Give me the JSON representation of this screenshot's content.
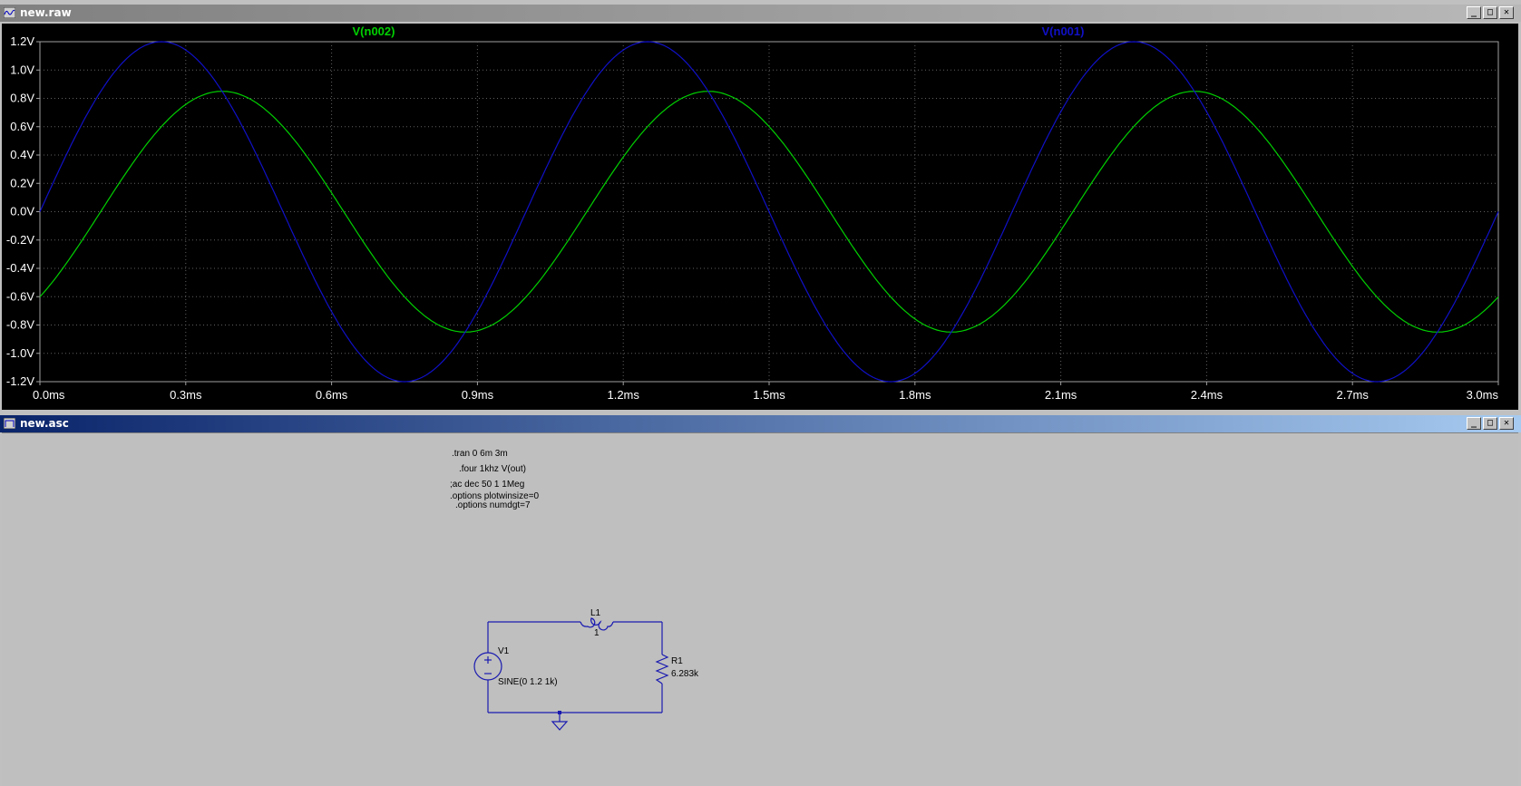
{
  "waveform_window": {
    "title": "new.raw",
    "buttons": {
      "minimize": "_",
      "restore": "□",
      "close": "✕"
    }
  },
  "schematic_window": {
    "title": "new.asc",
    "buttons": {
      "minimize": "_",
      "restore": "□",
      "close": "✕"
    }
  },
  "chart_data": {
    "type": "line",
    "xlabel": "",
    "ylabel": "",
    "xlim": [
      0,
      3.0
    ],
    "ylim": [
      -1.2,
      1.2
    ],
    "grid": true,
    "x_ticks": [
      "0.0ms",
      "0.3ms",
      "0.6ms",
      "0.9ms",
      "1.2ms",
      "1.5ms",
      "1.8ms",
      "2.1ms",
      "2.4ms",
      "2.7ms",
      "3.0ms"
    ],
    "y_ticks": [
      "1.2V",
      "1.0V",
      "0.8V",
      "0.6V",
      "0.4V",
      "0.2V",
      "0.0V",
      "-0.2V",
      "-0.4V",
      "-0.6V",
      "-0.8V",
      "-1.0V",
      "-1.2V"
    ],
    "series": [
      {
        "name": "V(n002)",
        "color": "#00d000",
        "amplitude": 0.85,
        "frequency_khz": 1,
        "phase_deg": -45
      },
      {
        "name": "V(n001)",
        "color": "#1010c8",
        "amplitude": 1.2,
        "frequency_khz": 1,
        "phase_deg": 0
      }
    ]
  },
  "directives": {
    "tran": ".tran 0 6m 3m",
    "four": ".four 1khz V(out)",
    "ac": ";ac dec 50 1 1Meg",
    "plotwinsize": ".options plotwinsize=0",
    "numdgt": ".options numdgt=7"
  },
  "components": {
    "v1": {
      "name": "V1",
      "value": "SINE(0 1.2 1k)"
    },
    "l1": {
      "name": "L1",
      "value": "1"
    },
    "r1": {
      "name": "R1",
      "value": "6.283k"
    }
  },
  "colors": {
    "wire": "#1a1ab0",
    "plot_bg": "#000000",
    "grid": "#606060"
  }
}
